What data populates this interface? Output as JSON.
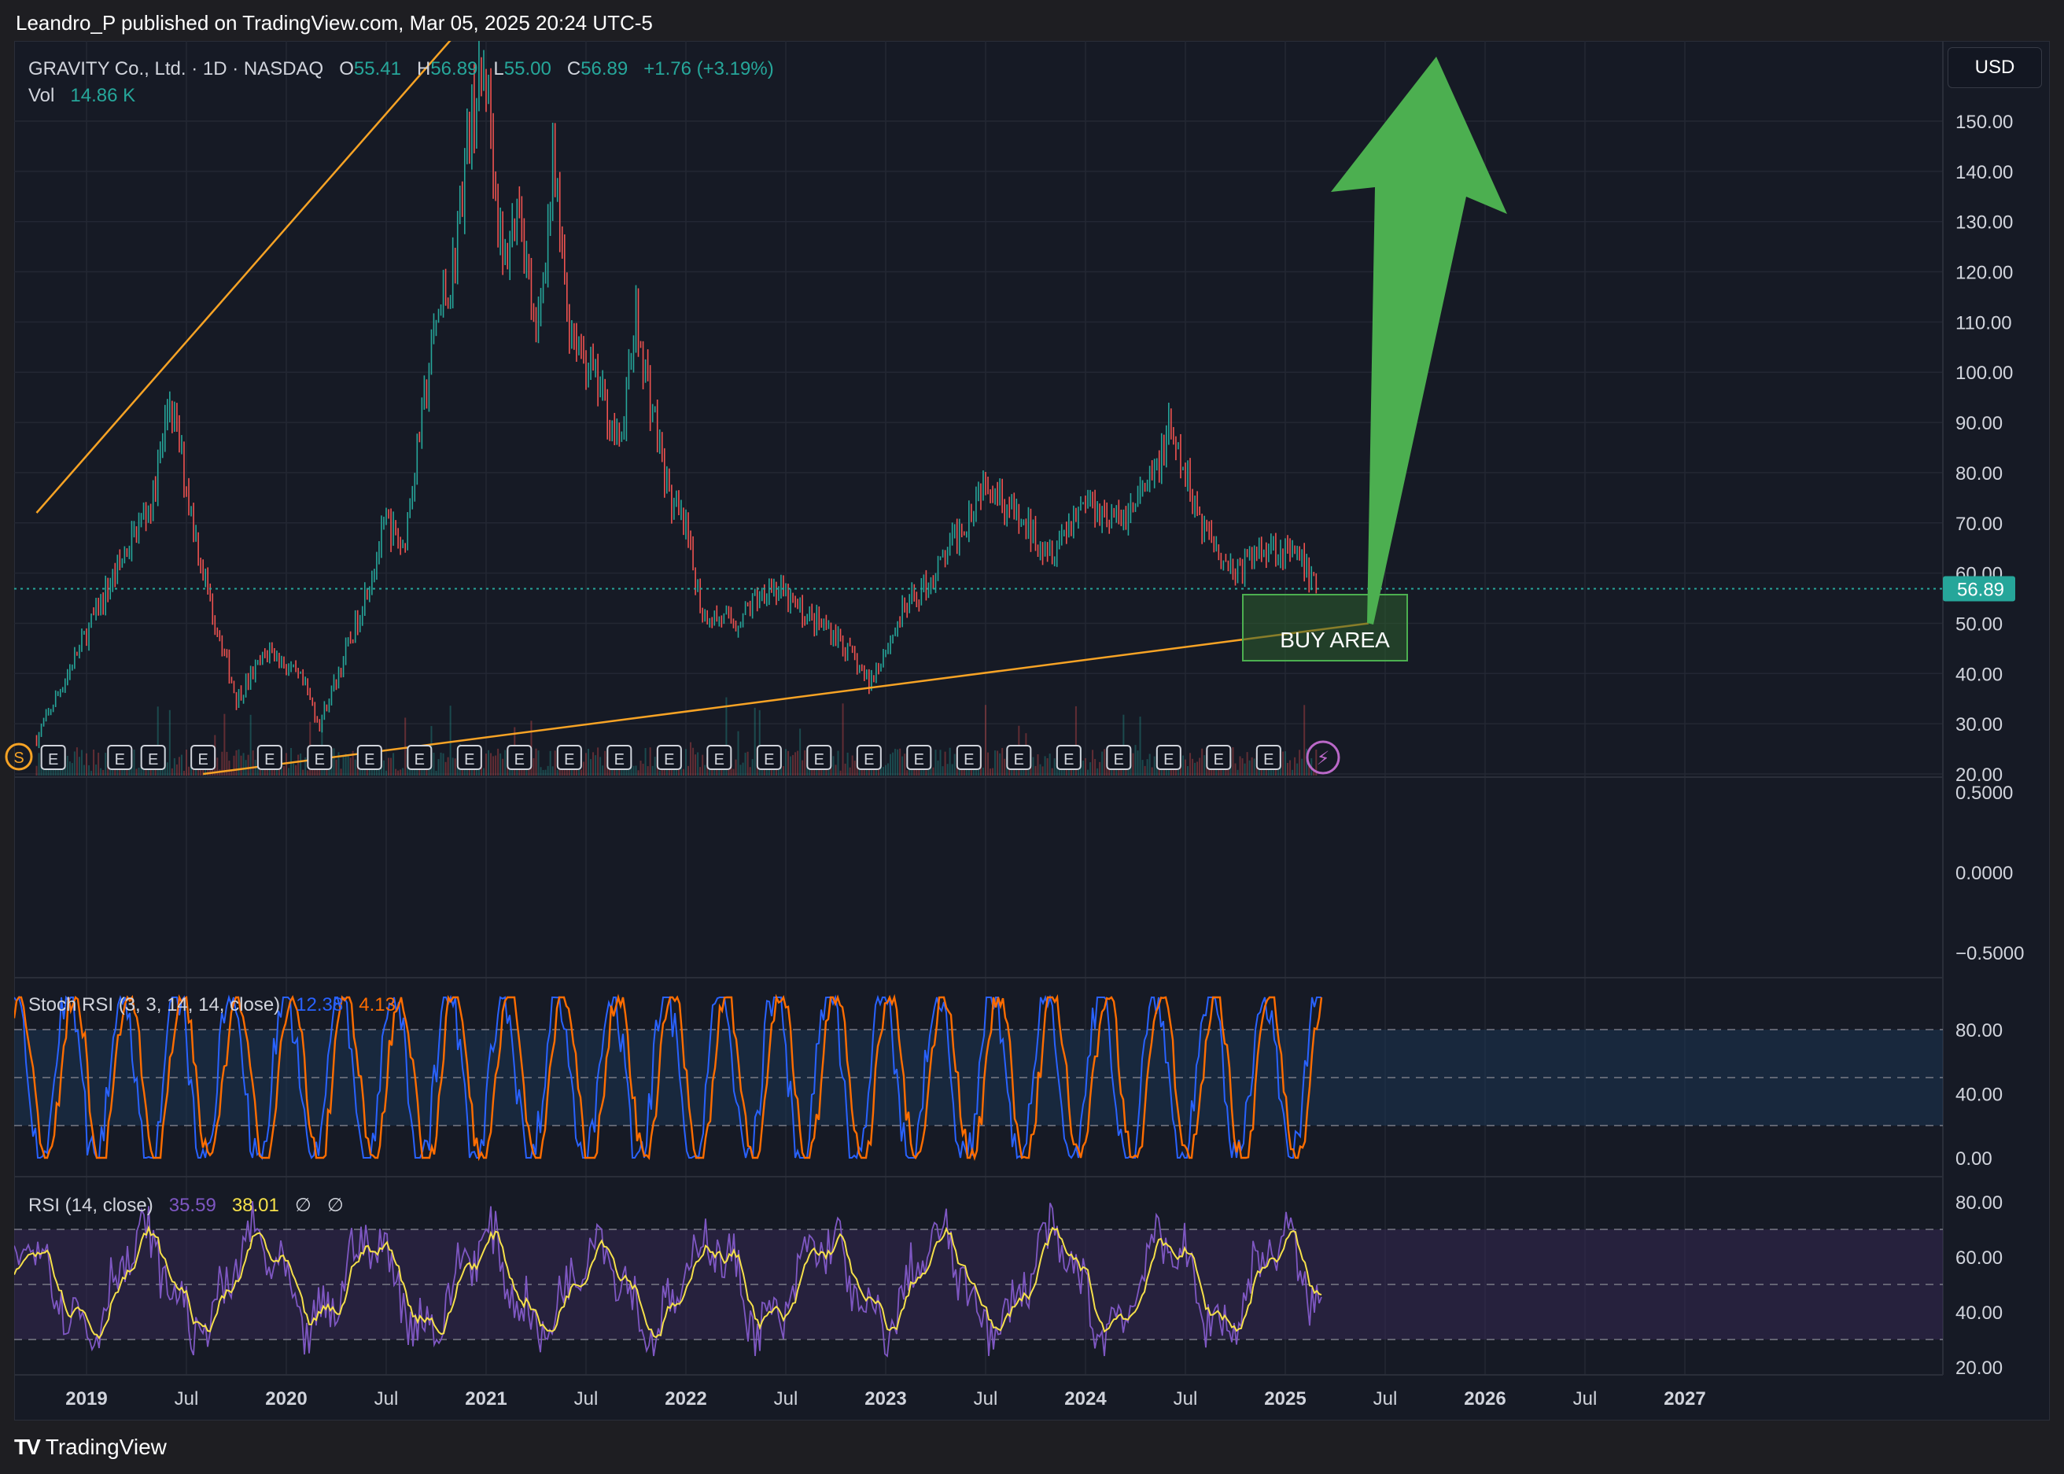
{
  "header": {
    "published": "Leandro_P published on TradingView.com, Mar 05, 2025 20:24 UTC-5"
  },
  "symbol": {
    "name": "GRAVITY Co., Ltd. · 1D · NASDAQ",
    "o_label": "O",
    "o": "55.41",
    "h_label": "H",
    "h": "56.89",
    "l_label": "L",
    "l": "55.00",
    "c_label": "C",
    "c": "56.89",
    "change": "+1.76 (+3.19%)",
    "vol_label": "Vol",
    "vol": "14.86 K"
  },
  "currency_button": "USD",
  "last_price_tag": "56.89",
  "annotation": {
    "buy_area": "BUY AREA"
  },
  "footer": {
    "brand": "TradingView",
    "brand_icon": "tradingview-logo-icon"
  },
  "colors": {
    "up": "#26a69a",
    "down": "#ef5350",
    "trendline": "#f7a325",
    "arrow": "#4caf50",
    "stoch_k": "#2962ff",
    "stoch_d": "#ff6d00",
    "rsi": "#7e57c2",
    "rsi_ma": "#f5e04a",
    "price_tag": "#26a69a"
  },
  "indicators": {
    "stoch": {
      "label": "Stoch RSI (3, 3, 14, 14, close)",
      "k": "12.38",
      "d": "4.13"
    },
    "rsi": {
      "label": "RSI (14, close)",
      "value": "35.59",
      "ma": "38.01",
      "extra1": "∅",
      "extra2": "∅"
    }
  },
  "earnings_marker": "E",
  "chart_data": {
    "type": "line",
    "title": "GRAVITY Co., Ltd. · 1D · NASDAQ",
    "x_ticks": [
      "2019",
      "Jul",
      "2020",
      "Jul",
      "2021",
      "Jul",
      "2022",
      "Jul",
      "2023",
      "Jul",
      "2024",
      "Jul",
      "2025",
      "Jul",
      "2026",
      "Jul",
      "2027"
    ],
    "price_axis_ticks": [
      "150.00",
      "140.00",
      "130.00",
      "120.00",
      "110.00",
      "100.00",
      "90.00",
      "80.00",
      "70.00",
      "60.00",
      "50.00",
      "40.00",
      "30.00",
      "20.00"
    ],
    "ylim": [
      20,
      160
    ],
    "series": [
      {
        "x": [
          "2018-10",
          "2019-01",
          "2019-03",
          "2019-05",
          "2019-06",
          "2019-08",
          "2019-10",
          "2019-12",
          "2020-02",
          "2020-03",
          "2020-05",
          "2020-07",
          "2020-08",
          "2020-10",
          "2020-11",
          "2020-12",
          "2021-01",
          "2021-02",
          "2021-03",
          "2021-04",
          "2021-05",
          "2021-06",
          "2021-08",
          "2021-09",
          "2021-10",
          "2021-12",
          "2022-01",
          "2022-02",
          "2022-04",
          "2022-06",
          "2022-08",
          "2022-10",
          "2022-12",
          "2023-02",
          "2023-04",
          "2023-06",
          "2023-07",
          "2023-09",
          "2023-11",
          "2024-01",
          "2024-03",
          "2024-05",
          "2024-06",
          "2024-08",
          "2024-10",
          "2024-12",
          "2025-02",
          "2025-03"
        ],
        "values": [
          27,
          48,
          62,
          75,
          95,
          60,
          35,
          45,
          38,
          30,
          48,
          70,
          65,
          110,
          120,
          150,
          160,
          120,
          135,
          105,
          140,
          110,
          95,
          85,
          110,
          75,
          68,
          52,
          50,
          58,
          52,
          48,
          38,
          52,
          60,
          72,
          80,
          70,
          65,
          75,
          70,
          78,
          88,
          70,
          60,
          66,
          62,
          56.89
        ]
      }
    ],
    "trendlines": [
      {
        "from": [
          "2018-10",
          72
        ],
        "to": [
          "2021-02",
          178
        ]
      },
      {
        "from": [
          "2019-08",
          20
        ],
        "to": [
          "2025-06",
          50
        ]
      }
    ],
    "earnings_x": [
      "2018-11",
      "2019-03",
      "2019-05",
      "2019-08",
      "2019-12",
      "2020-03",
      "2020-06",
      "2020-09",
      "2020-12",
      "2021-03",
      "2021-06",
      "2021-09",
      "2021-12",
      "2022-03",
      "2022-06",
      "2022-09",
      "2022-12",
      "2023-03",
      "2023-06",
      "2023-09",
      "2023-12",
      "2024-03",
      "2024-06",
      "2024-09",
      "2024-12"
    ],
    "stoch_rsi": {
      "ylim": [
        0,
        100
      ],
      "ticks": [
        "80.00",
        "40.00",
        "0.00"
      ],
      "k": 12.38,
      "d": 4.13
    },
    "rsi": {
      "ylim": [
        20,
        85
      ],
      "ticks": [
        "80.00",
        "60.00",
        "40.00",
        "20.00"
      ],
      "value": 35.59,
      "ma": 38.01
    },
    "empty_pane_ticks": [
      "0.5000",
      "0.0000",
      "−0.5000"
    ]
  }
}
